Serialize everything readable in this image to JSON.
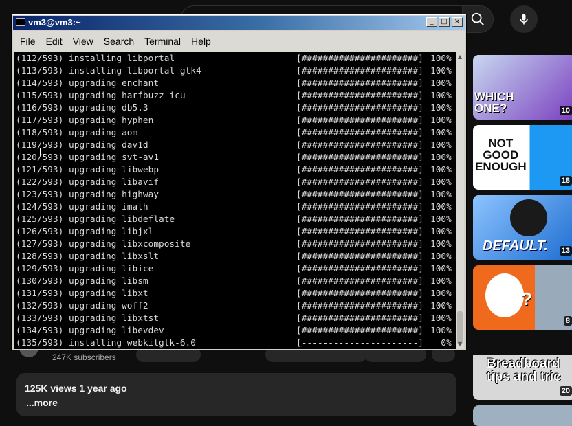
{
  "terminal": {
    "title": "vm3@vm3:~",
    "controls": {
      "minimize": "_",
      "maximize": "□",
      "close": "×"
    },
    "menu": [
      "File",
      "Edit",
      "View",
      "Search",
      "Terminal",
      "Help"
    ],
    "lines": [
      {
        "text": "(112/593) installing libportal",
        "bar": "[######################]",
        "pct": "100%"
      },
      {
        "text": "(113/593) installing libportal-gtk4",
        "bar": "[######################]",
        "pct": "100%"
      },
      {
        "text": "(114/593) upgrading enchant",
        "bar": "[######################]",
        "pct": "100%"
      },
      {
        "text": "(115/593) upgrading harfbuzz-icu",
        "bar": "[######################]",
        "pct": "100%"
      },
      {
        "text": "(116/593) upgrading db5.3",
        "bar": "[######################]",
        "pct": "100%"
      },
      {
        "text": "(117/593) upgrading hyphen",
        "bar": "[######################]",
        "pct": "100%"
      },
      {
        "text": "(118/593) upgrading aom",
        "bar": "[######################]",
        "pct": "100%"
      },
      {
        "text": "(119/593) upgrading dav1d",
        "bar": "[######################]",
        "pct": "100%"
      },
      {
        "text": "(120/593) upgrading svt-av1",
        "bar": "[######################]",
        "pct": "100%"
      },
      {
        "text": "(121/593) upgrading libwebp",
        "bar": "[######################]",
        "pct": "100%"
      },
      {
        "text": "(122/593) upgrading libavif",
        "bar": "[######################]",
        "pct": "100%"
      },
      {
        "text": "(123/593) upgrading highway",
        "bar": "[######################]",
        "pct": "100%"
      },
      {
        "text": "(124/593) upgrading imath",
        "bar": "[######################]",
        "pct": "100%"
      },
      {
        "text": "(125/593) upgrading libdeflate",
        "bar": "[######################]",
        "pct": "100%"
      },
      {
        "text": "(126/593) upgrading libjxl",
        "bar": "[######################]",
        "pct": "100%"
      },
      {
        "text": "(127/593) upgrading libxcomposite",
        "bar": "[######################]",
        "pct": "100%"
      },
      {
        "text": "(128/593) upgrading libxslt",
        "bar": "[######################]",
        "pct": "100%"
      },
      {
        "text": "(129/593) upgrading libice",
        "bar": "[######################]",
        "pct": "100%"
      },
      {
        "text": "(130/593) upgrading libsm",
        "bar": "[######################]",
        "pct": "100%"
      },
      {
        "text": "(131/593) upgrading libxt",
        "bar": "[######################]",
        "pct": "100%"
      },
      {
        "text": "(132/593) upgrading woff2",
        "bar": "[######################]",
        "pct": "100%"
      },
      {
        "text": "(133/593) upgrading libxtst",
        "bar": "[######################]",
        "pct": "100%"
      },
      {
        "text": "(134/593) upgrading libevdev",
        "bar": "[######################]",
        "pct": "100%"
      },
      {
        "text": "(135/593) installing webkitgtk-6.0",
        "bar": "[----------------------]",
        "pct": "0%"
      }
    ]
  },
  "background": {
    "subscribers": "247K subscribers",
    "description": {
      "meta": "125K views  1 year ago",
      "more": "...more"
    },
    "thumbnails": [
      {
        "text": "WHICH\nONE?",
        "duration": "10",
        "bg": "#7a3fc0"
      },
      {
        "text": "NOT\nGOOD\nENOUGH",
        "duration": "18",
        "bg": "#ffffff"
      },
      {
        "text": "DEFAULT.",
        "duration": "13",
        "bg": "#3a8ee6"
      },
      {
        "text": "?",
        "duration": "8",
        "bg": "#f06a1e"
      },
      {
        "text": "Breadboard\ntips and tric",
        "duration": "20",
        "bg": "#f5f5f5"
      }
    ],
    "icons": {
      "search": "search-icon",
      "mic": "mic-icon"
    }
  }
}
